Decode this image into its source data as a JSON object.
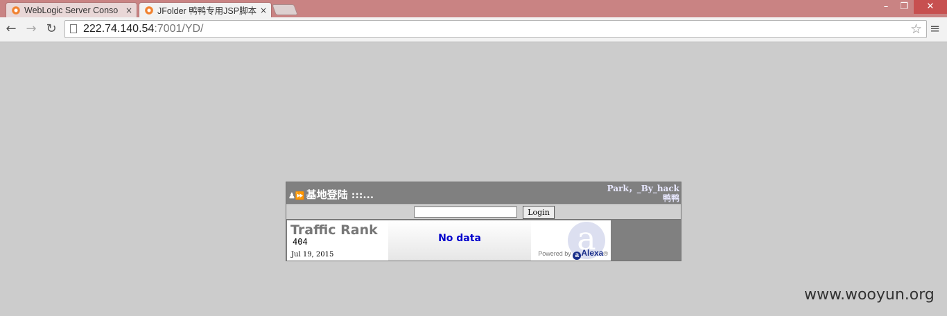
{
  "browser": {
    "tabs": [
      {
        "label": "WebLogic Server Conso",
        "close": "×",
        "active": false
      },
      {
        "label": "JFolder 鸭鸭专用JSP脚本",
        "close": "×",
        "active": true
      }
    ],
    "window_controls": {
      "minimize": "–",
      "maximize": "❐",
      "close": "✕"
    },
    "nav": {
      "back": "←",
      "forward": "→",
      "reload": "↻"
    },
    "address": {
      "host": "222.74.140.54",
      "rest": ":7001/YD/"
    },
    "star": "☆",
    "menu": "≡"
  },
  "login": {
    "title": "基地登陆 :::...",
    "title_icons": "♟⏩",
    "credit_line1": "Park，_By_hack",
    "credit_line2": "鸭鸭",
    "password_value": "",
    "button_label": "Login"
  },
  "alexa": {
    "title": "Traffic Rank",
    "rank": "404",
    "date": "Jul 19, 2015",
    "no_data": "No data",
    "logo_letter": "a",
    "powered_by": "Powered by",
    "brand_mark": "a",
    "brand": "Alexa",
    "brand_tm": "®"
  },
  "watermark": "www.wooyun.org"
}
